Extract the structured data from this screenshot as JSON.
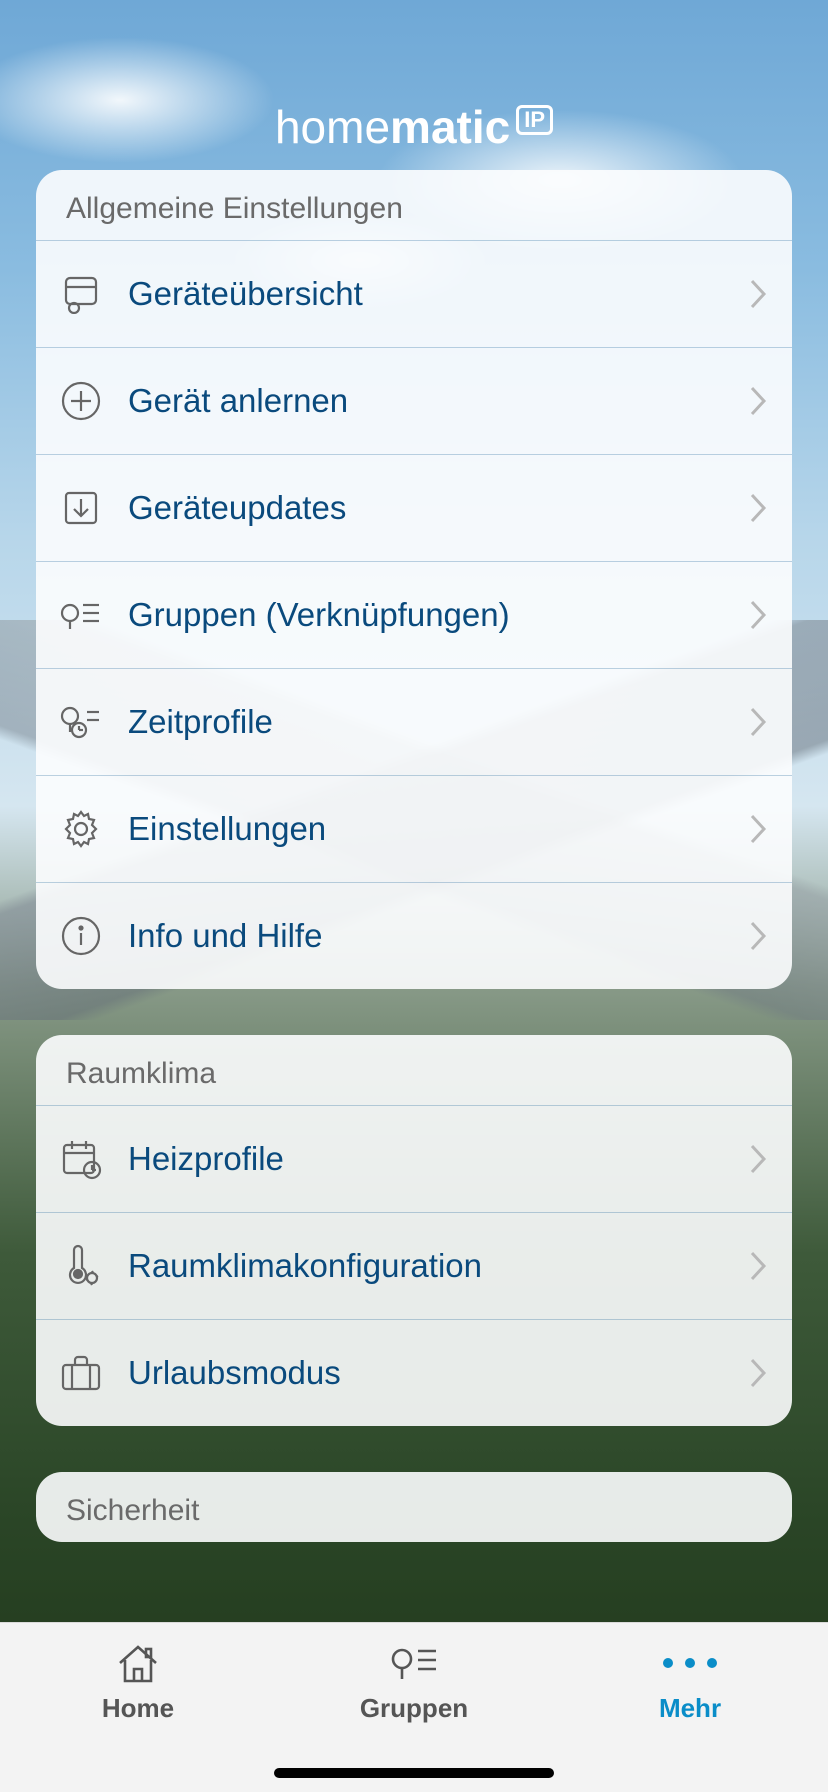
{
  "brand": {
    "prefix": "home",
    "bold": "matic",
    "badge": "IP"
  },
  "sections": [
    {
      "title": "Allgemeine Einstellungen",
      "items": [
        {
          "label": "Geräteübersicht"
        },
        {
          "label": "Gerät anlernen"
        },
        {
          "label": "Geräteupdates"
        },
        {
          "label": "Gruppen (Verknüpfungen)"
        },
        {
          "label": "Zeitprofile"
        },
        {
          "label": "Einstellungen"
        },
        {
          "label": "Info und Hilfe"
        }
      ]
    },
    {
      "title": "Raumklima",
      "items": [
        {
          "label": "Heizprofile"
        },
        {
          "label": "Raumklimakonfiguration"
        },
        {
          "label": "Urlaubsmodus"
        }
      ]
    },
    {
      "title": "Sicherheit",
      "items": []
    }
  ],
  "tabs": {
    "home": "Home",
    "groups": "Gruppen",
    "more": "Mehr"
  }
}
